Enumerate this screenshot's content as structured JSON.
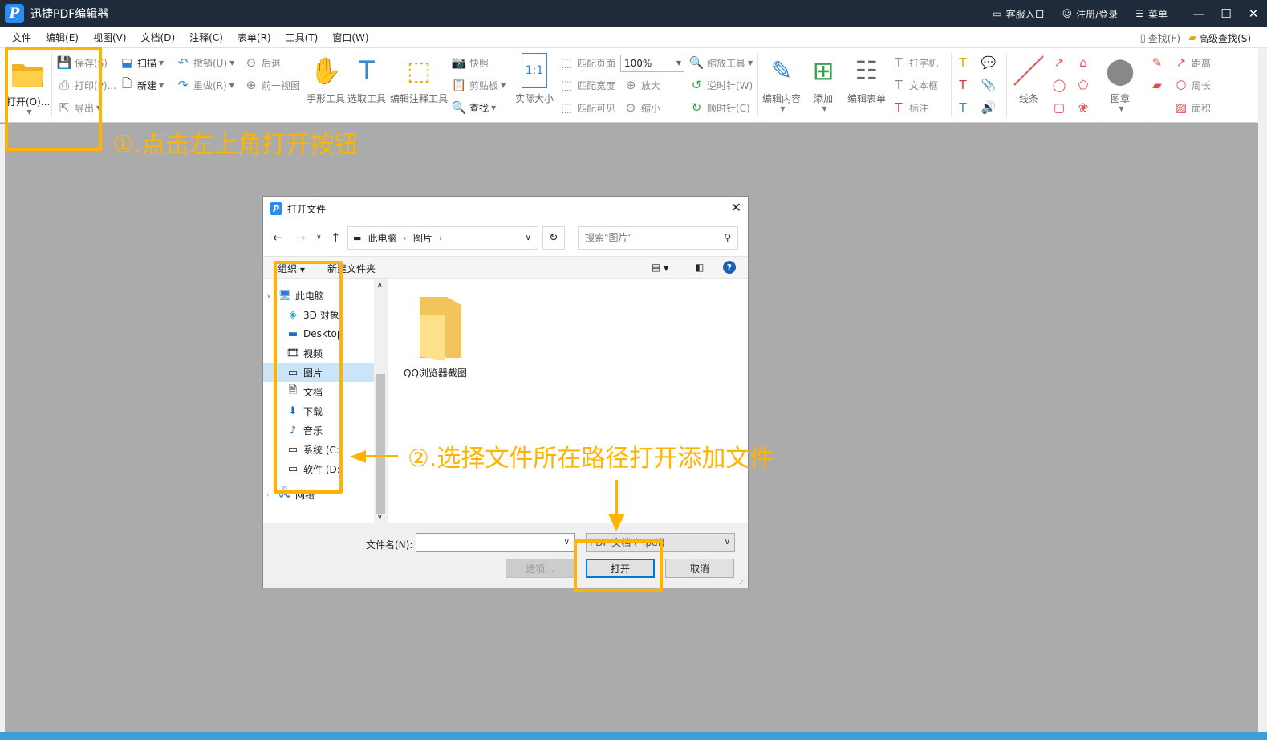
{
  "app": {
    "title": "迅捷PDF编辑器",
    "logo_letter": "P"
  },
  "titlebar": {
    "service": "客服入口",
    "login": "注册/登录",
    "menu": "菜单"
  },
  "menubar": {
    "items": [
      "文件",
      "编辑(E)",
      "视图(V)",
      "文档(D)",
      "注释(C)",
      "表单(R)",
      "工具(T)",
      "窗口(W)"
    ],
    "find": "查找(F)",
    "advanced_find": "高级查找(S)"
  },
  "ribbon": {
    "open": "打开(O)...",
    "save": "保存(S)",
    "print": "打印(P)...",
    "export": "导出",
    "scan": "扫描",
    "new": "新建",
    "undo": "撤销(U)",
    "redo": "重做(R)",
    "back": "后退",
    "prev_view": "前一视图",
    "hand_tool": "手形工具",
    "select_tool": "选取工具",
    "edit_annot": "编辑注释工具",
    "snapshot": "快照",
    "clipboard": "剪贴板",
    "find": "查找",
    "actual_size": "实际大小",
    "fit_page": "匹配页面",
    "fit_width": "匹配宽度",
    "fit_visible": "匹配可见",
    "zoom_value": "100%",
    "zoom_in": "放大",
    "zoom_out": "缩小",
    "zoom_tool": "缩放工具",
    "rotate_ccw": "逆时针(W)",
    "rotate_cw": "顺时针(C)",
    "edit_content": "编辑内容",
    "add": "添加",
    "edit_form": "编辑表单",
    "typewriter": "打字机",
    "textbox": "文本框",
    "callout": "标注",
    "lines": "线条",
    "stamp": "图章",
    "distance": "距离",
    "perimeter": "周长",
    "area": "面积",
    "actual_icon_text": "1:1"
  },
  "annotations": {
    "step1": "①.点击左上角打开按钮",
    "step2": "②.选择文件所在路径打开添加文件"
  },
  "dialog": {
    "title": "打开文件",
    "breadcrumb": [
      "此电脑",
      "图片"
    ],
    "search_placeholder": "搜索\"图片\"",
    "organize": "组织",
    "new_folder": "新建文件夹",
    "help": "?",
    "tree": [
      {
        "label": "此电脑",
        "icon": "computer-icon",
        "level": 0
      },
      {
        "label": "3D 对象",
        "icon": "cube-icon",
        "level": 1
      },
      {
        "label": "Desktop",
        "icon": "desktop-icon",
        "level": 1
      },
      {
        "label": "视频",
        "icon": "video-icon",
        "level": 1
      },
      {
        "label": "图片",
        "icon": "pictures-icon",
        "level": 1,
        "selected": true
      },
      {
        "label": "文档",
        "icon": "document-icon",
        "level": 1
      },
      {
        "label": "下载",
        "icon": "download-icon",
        "level": 1
      },
      {
        "label": "音乐",
        "icon": "music-icon",
        "level": 1
      },
      {
        "label": "系统 (C:)",
        "icon": "drive-icon",
        "level": 1
      },
      {
        "label": "软件 (D:)",
        "icon": "drive-icon",
        "level": 1
      },
      {
        "label": "网络",
        "icon": "network-icon",
        "level": 0
      }
    ],
    "folder_name": "QQ浏览器截图",
    "filename_label": "文件名(N):",
    "filename_value": "",
    "filetype": "PDF 文档 (*.pdf)",
    "options": "选项...",
    "open": "打开",
    "cancel": "取消"
  },
  "colors": {
    "accent": "#ffb400",
    "titlebar": "#1f2a3a",
    "selected": "#cce4f7"
  }
}
